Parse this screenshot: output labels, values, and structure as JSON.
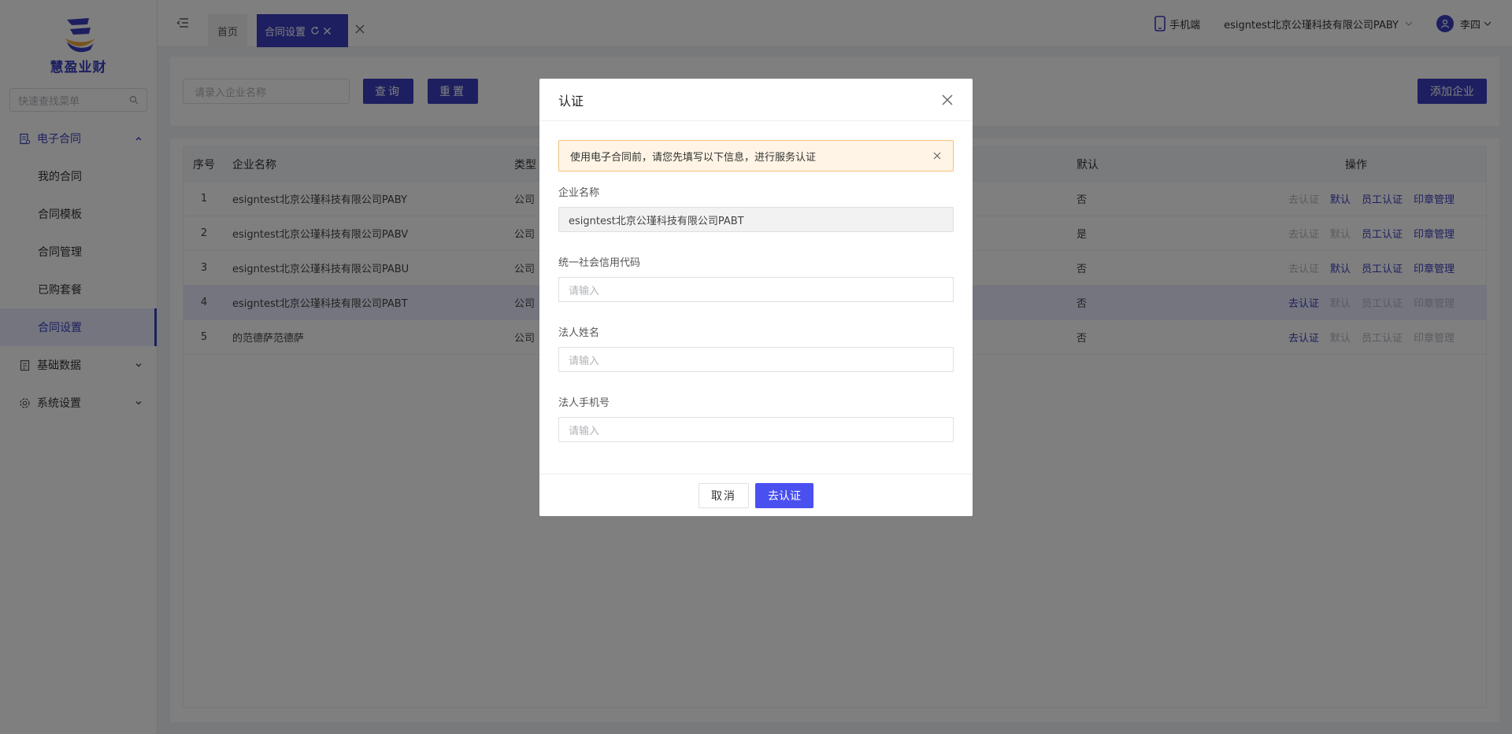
{
  "brand": {
    "name": "慧盈业财"
  },
  "sidebar": {
    "search_placeholder": "快速查找菜单",
    "groups": [
      {
        "label": "电子合同",
        "items": [
          "我的合同",
          "合同模板",
          "合同管理",
          "已购套餐",
          "合同设置"
        ]
      },
      {
        "label": "基础数据"
      },
      {
        "label": "系统设置"
      }
    ]
  },
  "header": {
    "tabs": [
      {
        "label": "首页"
      },
      {
        "label": "合同设置"
      }
    ],
    "mobile_label": "手机端",
    "company": "esigntest北京公瑾科技有限公司PABY",
    "user": "李四"
  },
  "filter": {
    "placeholder": "请录入企业名称",
    "query_label": "查询",
    "reset_label": "重置",
    "add_label": "添加企业"
  },
  "table": {
    "headers": {
      "idx": "序号",
      "name": "企业名称",
      "type": "类型",
      "default": "默认",
      "ops": "操作"
    },
    "op_labels": {
      "verify": "去认证",
      "set_default": "默认",
      "staff": "员工认证",
      "seal": "印章管理"
    },
    "rows": [
      {
        "idx": "1",
        "name": "esigntest北京公瑾科技有限公司PABY",
        "type": "公司",
        "default": "否"
      },
      {
        "idx": "2",
        "name": "esigntest北京公瑾科技有限公司PABV",
        "type": "公司",
        "default": "是"
      },
      {
        "idx": "3",
        "name": "esigntest北京公瑾科技有限公司PABU",
        "type": "公司",
        "default": "否"
      },
      {
        "idx": "4",
        "name": "esigntest北京公瑾科技有限公司PABT",
        "type": "公司",
        "default": "否"
      },
      {
        "idx": "5",
        "name": "的范德萨范德萨",
        "type": "公司",
        "default": "否"
      }
    ]
  },
  "dialog": {
    "title": "认证",
    "alert": "使用电子合同前，请您先填写以下信息，进行服务认证",
    "fields": {
      "company_label": "企业名称",
      "company_value": "esigntest北京公瑾科技有限公司PABT",
      "credit_label": "统一社会信用代码",
      "legal_name_label": "法人姓名",
      "legal_phone_label": "法人手机号",
      "placeholder": "请输入"
    },
    "cancel_label": "取消",
    "confirm_label": "去认证"
  },
  "colors": {
    "primary": "#3a3fc0",
    "confirm": "#4a50f0",
    "alert_bg": "#fff4e5"
  }
}
